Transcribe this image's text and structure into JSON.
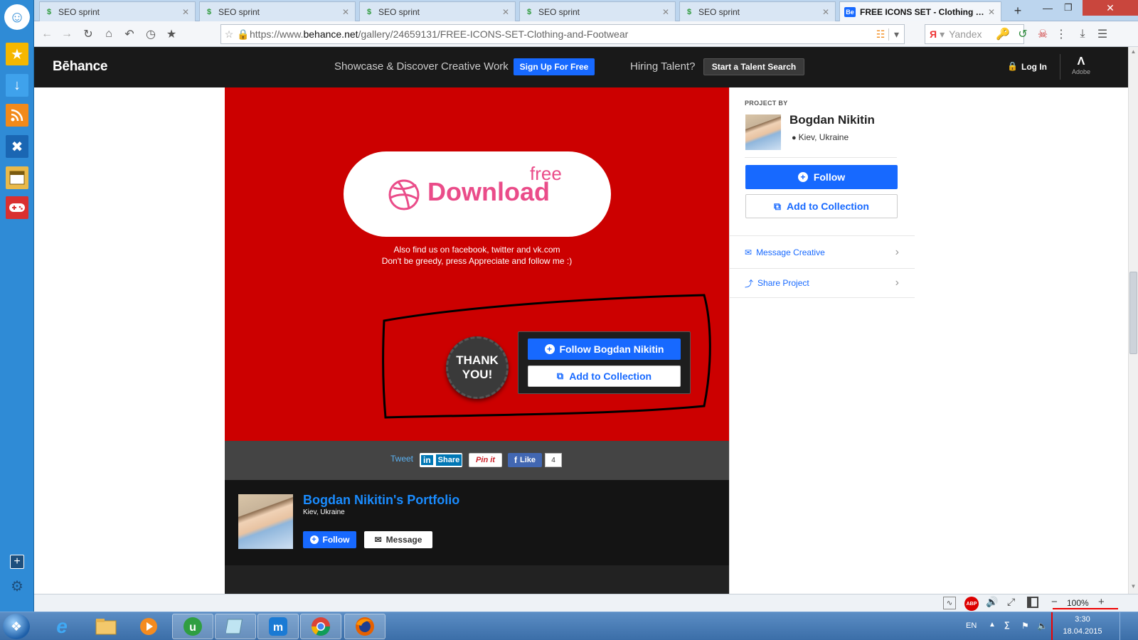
{
  "browser": {
    "tabs": [
      {
        "title": "SEO sprint",
        "active": false
      },
      {
        "title": "SEO sprint",
        "active": false
      },
      {
        "title": "SEO sprint",
        "active": false
      },
      {
        "title": "SEO sprint",
        "active": false
      },
      {
        "title": "SEO sprint",
        "active": false
      },
      {
        "title": "FREE ICONS SET - Clothing and ...",
        "active": true
      }
    ],
    "url_prefix": "https://www.",
    "url_domain": "behance.net",
    "url_path": "/gallery/24659131/FREE-ICONS-SET-Clothing-and-Footwear",
    "search_placeholder": "Yandex",
    "favicon_be": "Be"
  },
  "header": {
    "logo": "Bēhance",
    "tagline": "Showcase & Discover Creative Work",
    "signup_label": "Sign Up For Free",
    "hiring_text": "Hiring Talent?",
    "talent_search_label": "Start a Talent Search",
    "login_label": "Log In",
    "adobe_label": "Adobe"
  },
  "project": {
    "download_free": "free",
    "download_label": "Download",
    "note_line1": "Also find us on facebook, twitter and vk.com",
    "note_line2": "Don't be greedy, press Appreciate and follow me :)",
    "thank_you_line1": "THANK",
    "thank_you_line2": "YOU!",
    "follow_owner_label": "Follow Bogdan Nikitin",
    "add_collection_label": "Add to Collection"
  },
  "share": {
    "tweet": "Tweet",
    "linkedin": "Share",
    "pinterest": "Pin it",
    "facebook": "Like",
    "facebook_count": "4"
  },
  "portfolio": {
    "title": "Bogdan Nikitin's Portfolio",
    "location": "Kiev, Ukraine",
    "follow_label": "Follow",
    "message_label": "Message"
  },
  "sidebar_right": {
    "project_by": "PROJECT BY",
    "owner_name": "Bogdan Nikitin",
    "owner_location": "Kiev, Ukraine",
    "follow_label": "Follow",
    "add_collection_label": "Add to Collection",
    "message_label": "Message Creative",
    "share_label": "Share Project"
  },
  "status": {
    "zoom": "100%",
    "abp": "ABP"
  },
  "taskbar": {
    "lang": "EN",
    "time": "3:30",
    "date": "18.04.2015"
  },
  "colors": {
    "behance_blue": "#1769ff",
    "project_red": "#cc0000",
    "header_black": "#191919",
    "dribbble_pink": "#ea4c89"
  }
}
